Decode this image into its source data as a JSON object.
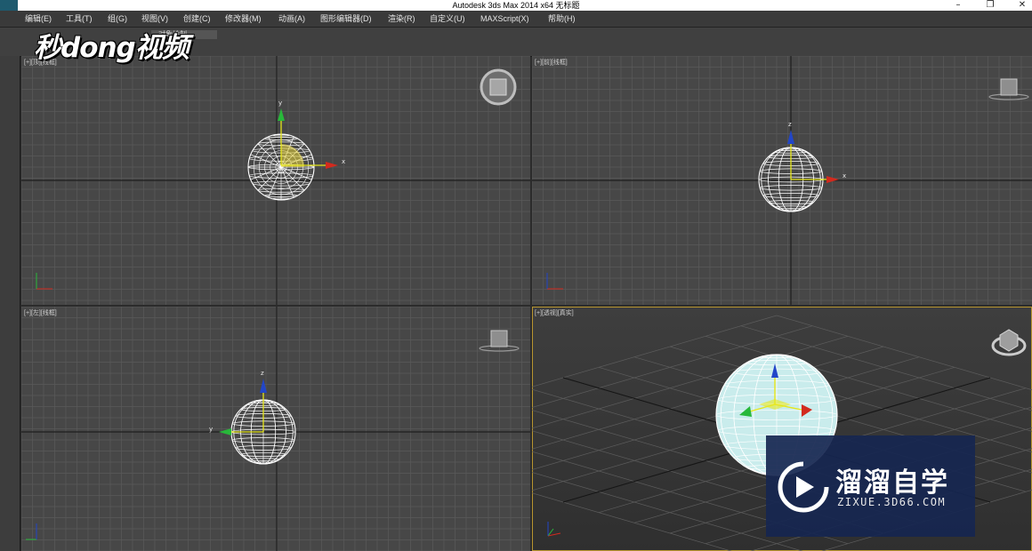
{
  "window": {
    "title": "Autodesk 3ds Max  2014 x64      无标题",
    "minimize_glyph": "–",
    "restore_glyph": "❐",
    "close_glyph": "✕"
  },
  "menu": {
    "items": [
      {
        "label": "编辑(E)"
      },
      {
        "label": "工具(T)"
      },
      {
        "label": "组(G)"
      },
      {
        "label": "视图(V)"
      },
      {
        "label": "创建(C)"
      },
      {
        "label": "修改器(M)"
      },
      {
        "label": "动画(A)"
      },
      {
        "label": "图形编辑器(D)"
      },
      {
        "label": "渲染(R)"
      },
      {
        "label": "自定义(U)"
      },
      {
        "label": "MAXScript(X)"
      },
      {
        "label": "帮助(H)"
      }
    ]
  },
  "toolbar": {
    "tab_label": "对象绘制"
  },
  "watermark": {
    "logo_text": "秒dong视频"
  },
  "viewports": {
    "top": {
      "label": "[+][顶][线框]"
    },
    "front": {
      "label": "[+][前][线框]"
    },
    "left": {
      "label": "[+][左][线框]"
    },
    "perspective": {
      "label": "[+][透视][真实]"
    }
  },
  "axis_labels": {
    "x": "x",
    "y": "y",
    "z": "z"
  },
  "brand": {
    "name": "溜溜自学",
    "url": "ZIXUE.3D66.COM"
  },
  "colors": {
    "viewport_bg": "#474747",
    "grid_line": "#5a5a5a",
    "active_border": "#b8952f",
    "brand_bg": "#162650",
    "sphere_shaded": "#c9ecec"
  }
}
